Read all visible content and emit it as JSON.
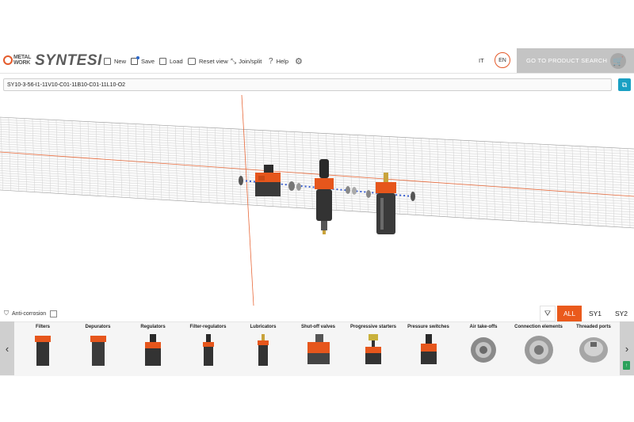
{
  "header": {
    "logo_top": "METAL",
    "logo_bottom": "WORK",
    "app_name": "SYNTESI",
    "toolbar": [
      {
        "label": "New",
        "icon": "new-icon"
      },
      {
        "label": "Save",
        "icon": "save-icon"
      },
      {
        "label": "Load",
        "icon": "load-icon"
      },
      {
        "label": "Reset view",
        "icon": "reset-view-icon"
      },
      {
        "label": "Join/split",
        "icon": "join-split-icon"
      },
      {
        "label": "Help",
        "icon": "help-icon"
      }
    ],
    "lang_it": "IT",
    "lang_en": "EN",
    "goto_label": "GO TO PRODUCT SEARCH"
  },
  "code": {
    "value": "SY10-3-56-I1-11V10-C01-11B10-C01-11L10-O2"
  },
  "bottom": {
    "anti_corrosion_label": "Anti-corrosion",
    "anti_corrosion_checked": false,
    "tabs": [
      {
        "label": "ALL",
        "active": true
      },
      {
        "label": "SY1",
        "active": false
      },
      {
        "label": "SY2",
        "active": false
      }
    ],
    "categories": [
      {
        "label": "Filters"
      },
      {
        "label": "Depurators"
      },
      {
        "label": "Regulators"
      },
      {
        "label": "Filter-regulators"
      },
      {
        "label": "Lubricators"
      },
      {
        "label": "Shut-off valves"
      },
      {
        "label": "Progressive starters"
      },
      {
        "label": "Pressure switches"
      },
      {
        "label": "Air take-offs"
      },
      {
        "label": "Connection elements"
      },
      {
        "label": "Threaded ports"
      }
    ]
  },
  "colors": {
    "accent": "#ea5a1c",
    "copy_button": "#1aa0c3",
    "goto_bg": "#c4c4c4"
  }
}
